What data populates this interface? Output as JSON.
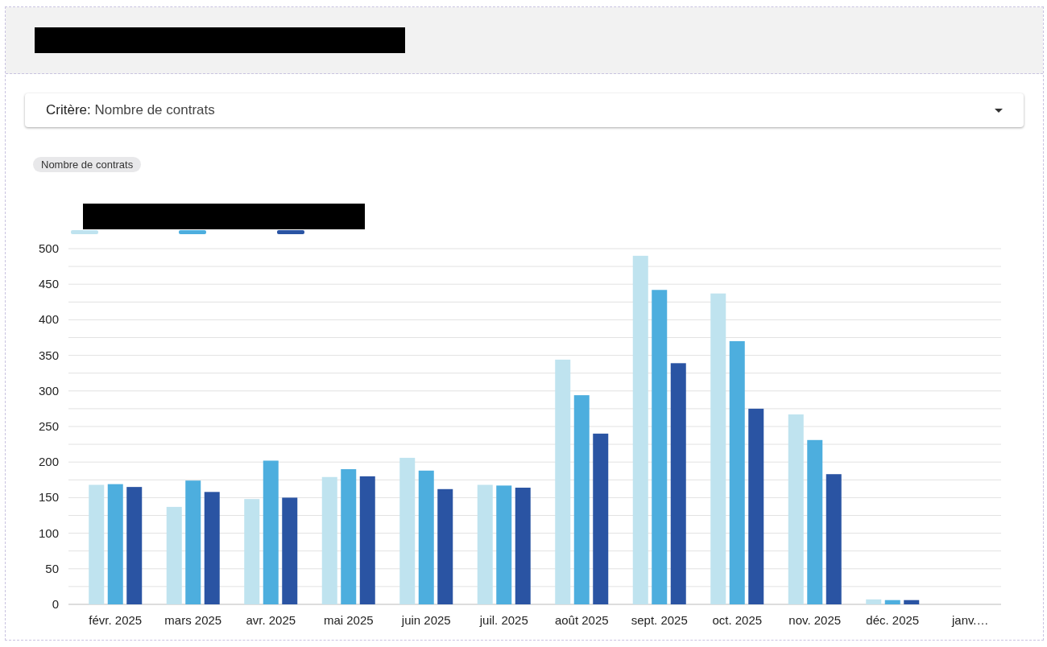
{
  "filter": {
    "label": "Critère:",
    "value": "Nombre de contrats"
  },
  "chip": {
    "label": "Nombre de contrats"
  },
  "chart": {
    "chart_data": {
      "type": "bar",
      "categories": [
        "févr. 2025",
        "mars 2025",
        "avr. 2025",
        "mai 2025",
        "juin 2025",
        "juil. 2025",
        "août 2025",
        "sept. 2025",
        "oct. 2025",
        "nov. 2025",
        "déc. 2025",
        "janv.…"
      ],
      "series": [
        {
          "color": "#bfe3ef",
          "values": [
            168,
            137,
            148,
            179,
            206,
            168,
            344,
            490,
            437,
            267,
            7,
            0
          ]
        },
        {
          "color": "#4daede",
          "values": [
            169,
            174,
            202,
            190,
            188,
            167,
            294,
            442,
            370,
            231,
            6,
            0
          ]
        },
        {
          "color": "#2a54a3",
          "values": [
            165,
            158,
            150,
            180,
            162,
            164,
            240,
            339,
            275,
            183,
            6,
            0
          ]
        }
      ],
      "grid": true,
      "ylim": [
        0,
        500
      ],
      "yticks": [
        0,
        50,
        100,
        150,
        200,
        250,
        300,
        350,
        400,
        450,
        500
      ]
    }
  }
}
